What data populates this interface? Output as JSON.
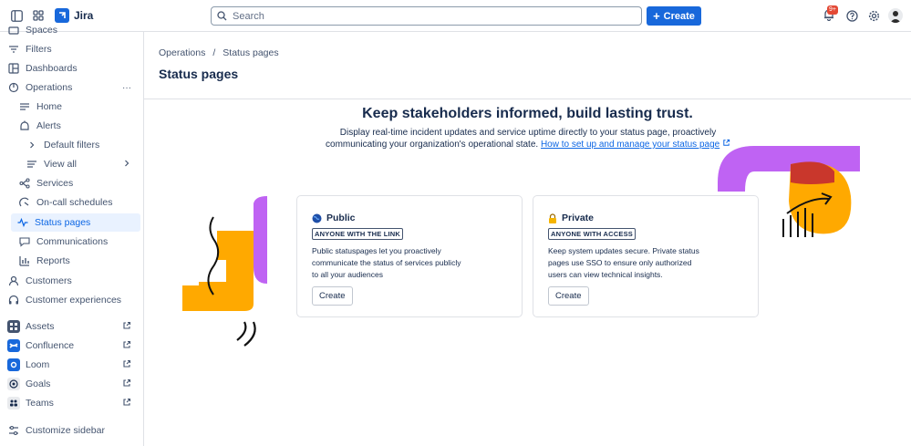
{
  "topbar": {
    "app_name": "Jira",
    "search_placeholder": "Search",
    "create_label": "Create",
    "notification_count": "9+"
  },
  "sidebar": {
    "items": [
      {
        "label": "Spaces",
        "icon": "spaces-icon"
      },
      {
        "label": "Filters",
        "icon": "filter-icon"
      },
      {
        "label": "Dashboards",
        "icon": "dashboard-icon"
      },
      {
        "label": "Operations",
        "icon": "operations-icon",
        "more": "···"
      },
      {
        "label": "Home",
        "icon": "home-icon"
      },
      {
        "label": "Alerts",
        "icon": "alert-icon"
      },
      {
        "label": "Default filters",
        "icon": "chevron-right-icon"
      },
      {
        "label": "View all",
        "icon": "list-icon"
      },
      {
        "label": "Services",
        "icon": "services-icon"
      },
      {
        "label": "On-call schedules",
        "icon": "schedule-icon"
      },
      {
        "label": "Status pages",
        "icon": "status-pages-icon"
      },
      {
        "label": "Communications",
        "icon": "communications-icon"
      },
      {
        "label": "Reports",
        "icon": "reports-icon"
      },
      {
        "label": "Customers",
        "icon": "customers-icon"
      },
      {
        "label": "Customer experiences",
        "icon": "headset-icon"
      },
      {
        "label": "Assets",
        "icon": "assets-app-icon"
      },
      {
        "label": "Confluence",
        "icon": "confluence-app-icon"
      },
      {
        "label": "Loom",
        "icon": "loom-app-icon"
      },
      {
        "label": "Goals",
        "icon": "goals-app-icon"
      },
      {
        "label": "Teams",
        "icon": "teams-app-icon"
      },
      {
        "label": "Customize sidebar",
        "icon": "customize-icon"
      }
    ]
  },
  "main": {
    "breadcrumb": [
      "Operations",
      "/",
      "Status pages"
    ],
    "title": "Status pages",
    "hero_title": "Keep stakeholders informed, build lasting trust.",
    "hero_sub_1": "Display real-time incident updates and service uptime directly to your status page, proactively",
    "hero_sub_2": "communicating your organization's operational state.",
    "hero_link": "How to set up and manage your status page",
    "cards": [
      {
        "title": "Public",
        "tag": "ANYONE WITH THE LINK",
        "description": "Public statuspages let you proactively communicate the status of services publicly to all your audiences",
        "button": "Create"
      },
      {
        "title": "Private",
        "tag": "ANYONE WITH ACCESS",
        "description": "Keep system updates secure. Private status pages use SSO to ensure only authorized users can view technical insights.",
        "button": "Create"
      }
    ]
  },
  "colors": {
    "accent": "#1868db",
    "purple": "#bf63f3",
    "orange": "#ffa900",
    "red": "#c9372c"
  }
}
